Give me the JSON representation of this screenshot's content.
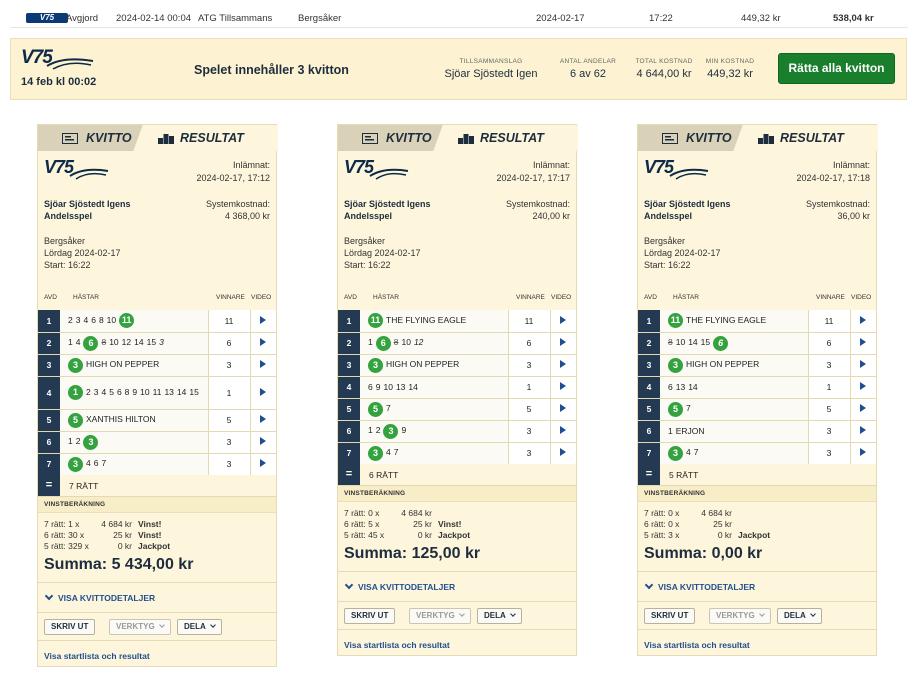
{
  "top_row": {
    "logo": "V75",
    "status": "Avgjord",
    "created": "2024-02-14 00:04",
    "type": "ATG Tillsammans",
    "track": "Bergsåker",
    "race_date": "2024-02-17",
    "time": "17:22",
    "min_cost": "449,32 kr",
    "total": "538,04 kr"
  },
  "banner": {
    "brand": "V75",
    "date": "14 feb kl 00:02",
    "info": "Spelet innehåller 3 kvitton",
    "stats": [
      {
        "label": "TILLSAMMANSLAG",
        "value": "Sjöar Sjöstedt Igen"
      },
      {
        "label": "ANTAL ANDELAR",
        "value": "6 av 62"
      },
      {
        "label": "TOTAL KOSTNAD",
        "value": "4 644,00 kr"
      },
      {
        "label": "MIN KOSTNAD",
        "value": "449,32 kr"
      }
    ],
    "fix_button": "Rätta alla kvitton"
  },
  "labels": {
    "tab_kvitto": "KVITTO",
    "tab_resultat": "RESULTAT",
    "inlamnat": "Inlämnat:",
    "systemkostnad": "Systemkostnad:",
    "col_avd": "AVD",
    "col_hastar": "HÄSTAR",
    "col_vinnare": "VINNARE",
    "col_video": "VIDEO",
    "eq": "=",
    "vinstberakning": "VINSTBERÄKNING",
    "visa_detaljer": "VISA KVITTODETALJER",
    "skriv_ut": "SKRIV UT",
    "verktyg": "VERKTYG",
    "dela": "DELA",
    "startlista": "Visa startlista och resultat"
  },
  "cards": [
    {
      "brand": "V75",
      "submitted": "2024-02-17, 17:12",
      "team_line1": "Sjöar Sjöstedt Igens",
      "team_line2": "Andelsspel",
      "system_cost": "4 368,00 kr",
      "track": "Bergsåker",
      "day": "Lördag 2024-02-17",
      "start": "Start: 16:22",
      "legs": [
        {
          "avd": "1",
          "winner": "11",
          "horses": [
            {
              "t": "2"
            },
            {
              "t": "3"
            },
            {
              "t": "4"
            },
            {
              "t": "6"
            },
            {
              "t": "8"
            },
            {
              "t": "10"
            },
            {
              "t": "11",
              "hit": true
            }
          ]
        },
        {
          "avd": "2",
          "winner": "6",
          "horses": [
            {
              "t": "1"
            },
            {
              "t": "4"
            },
            {
              "t": "6",
              "hit": true
            },
            {
              "t": "8",
              "strike": true
            },
            {
              "t": "10"
            },
            {
              "t": "12"
            },
            {
              "t": "14"
            },
            {
              "t": "15"
            },
            {
              "t": "3",
              "italic": true
            }
          ]
        },
        {
          "avd": "3",
          "winner": "3",
          "horses": [
            {
              "t": "3",
              "hit": true
            },
            {
              "t": "HIGH ON PEPPER"
            }
          ]
        },
        {
          "avd": "4",
          "winner": "1",
          "horses": [
            {
              "t": "1",
              "hit": true
            },
            {
              "t": "2"
            },
            {
              "t": "3"
            },
            {
              "t": "4"
            },
            {
              "t": "5"
            },
            {
              "t": "6"
            },
            {
              "t": "8"
            },
            {
              "t": "9"
            },
            {
              "t": "10"
            },
            {
              "t": "11"
            },
            {
              "t": "13"
            },
            {
              "t": "14"
            },
            {
              "t": "15"
            }
          ]
        },
        {
          "avd": "5",
          "winner": "5",
          "horses": [
            {
              "t": "5",
              "hit": true
            },
            {
              "t": "XANTHIS HILTON"
            }
          ]
        },
        {
          "avd": "6",
          "winner": "3",
          "horses": [
            {
              "t": "1"
            },
            {
              "t": "2"
            },
            {
              "t": "3",
              "hit": true
            }
          ]
        },
        {
          "avd": "7",
          "winner": "3",
          "horses": [
            {
              "t": "3",
              "hit": true
            },
            {
              "t": "4"
            },
            {
              "t": "6"
            },
            {
              "t": "7"
            }
          ]
        }
      ],
      "ratt": "7 RÄTT",
      "winnings": [
        {
          "rows": "7 rätt: 1 x",
          "amount": "4 684 kr",
          "result": "Vinst!"
        },
        {
          "rows": "6 rätt: 30 x",
          "amount": "25 kr",
          "result": "Vinst!"
        },
        {
          "rows": "5 rätt: 329 x",
          "amount": "0 kr",
          "result": "Jackpot"
        }
      ],
      "summa": "Summa: 5 434,00 kr"
    },
    {
      "brand": "V75",
      "submitted": "2024-02-17, 17:17",
      "team_line1": "Sjöar Sjöstedt Igens",
      "team_line2": "Andelsspel",
      "system_cost": "240,00 kr",
      "track": "Bergsåker",
      "day": "Lördag 2024-02-17",
      "start": "Start: 16:22",
      "legs": [
        {
          "avd": "1",
          "winner": "11",
          "horses": [
            {
              "t": "11",
              "hit": true
            },
            {
              "t": "THE FLYING EAGLE"
            }
          ]
        },
        {
          "avd": "2",
          "winner": "6",
          "horses": [
            {
              "t": "1"
            },
            {
              "t": "6",
              "hit": true
            },
            {
              "t": "8",
              "strike": true
            },
            {
              "t": "10"
            },
            {
              "t": "12",
              "italic": true
            }
          ]
        },
        {
          "avd": "3",
          "winner": "3",
          "horses": [
            {
              "t": "3",
              "hit": true
            },
            {
              "t": "HIGH ON PEPPER"
            }
          ]
        },
        {
          "avd": "4",
          "winner": "1",
          "horses": [
            {
              "t": "6"
            },
            {
              "t": "9"
            },
            {
              "t": "10"
            },
            {
              "t": "13"
            },
            {
              "t": "14"
            }
          ]
        },
        {
          "avd": "5",
          "winner": "5",
          "horses": [
            {
              "t": "5",
              "hit": true
            },
            {
              "t": "7"
            }
          ]
        },
        {
          "avd": "6",
          "winner": "3",
          "horses": [
            {
              "t": "1"
            },
            {
              "t": "2"
            },
            {
              "t": "3",
              "hit": true
            },
            {
              "t": "9"
            }
          ]
        },
        {
          "avd": "7",
          "winner": "3",
          "horses": [
            {
              "t": "3",
              "hit": true
            },
            {
              "t": "4"
            },
            {
              "t": "7"
            }
          ]
        }
      ],
      "ratt": "6 RÄTT",
      "winnings": [
        {
          "rows": "7 rätt: 0 x",
          "amount": "4 684 kr",
          "result": ""
        },
        {
          "rows": "6 rätt: 5 x",
          "amount": "25 kr",
          "result": "Vinst!"
        },
        {
          "rows": "5 rätt: 45 x",
          "amount": "0 kr",
          "result": "Jackpot"
        }
      ],
      "summa": "Summa: 125,00 kr"
    },
    {
      "brand": "V75",
      "submitted": "2024-02-17, 17:18",
      "team_line1": "Sjöar Sjöstedt Igens",
      "team_line2": "Andelsspel",
      "system_cost": "36,00 kr",
      "track": "Bergsåker",
      "day": "Lördag 2024-02-17",
      "start": "Start: 16:22",
      "legs": [
        {
          "avd": "1",
          "winner": "11",
          "horses": [
            {
              "t": "11",
              "hit": true
            },
            {
              "t": "THE FLYING EAGLE"
            }
          ]
        },
        {
          "avd": "2",
          "winner": "6",
          "horses": [
            {
              "t": "8",
              "strike": true
            },
            {
              "t": "10"
            },
            {
              "t": "14"
            },
            {
              "t": "15"
            },
            {
              "t": "6",
              "hit": true,
              "italic": true
            }
          ]
        },
        {
          "avd": "3",
          "winner": "3",
          "horses": [
            {
              "t": "3",
              "hit": true
            },
            {
              "t": "HIGH ON PEPPER"
            }
          ]
        },
        {
          "avd": "4",
          "winner": "1",
          "horses": [
            {
              "t": "6"
            },
            {
              "t": "13"
            },
            {
              "t": "14"
            }
          ]
        },
        {
          "avd": "5",
          "winner": "5",
          "horses": [
            {
              "t": "5",
              "hit": true
            },
            {
              "t": "7"
            }
          ]
        },
        {
          "avd": "6",
          "winner": "3",
          "horses": [
            {
              "t": "1"
            },
            {
              "t": "ERJON"
            }
          ]
        },
        {
          "avd": "7",
          "winner": "3",
          "horses": [
            {
              "t": "3",
              "hit": true
            },
            {
              "t": "4"
            },
            {
              "t": "7"
            }
          ]
        }
      ],
      "ratt": "5 RÄTT",
      "winnings": [
        {
          "rows": "7 rätt: 0 x",
          "amount": "4 684 kr",
          "result": ""
        },
        {
          "rows": "6 rätt: 0 x",
          "amount": "25 kr",
          "result": ""
        },
        {
          "rows": "5 rätt: 3 x",
          "amount": "0 kr",
          "result": "Jackpot"
        }
      ],
      "summa": "Summa: 0,00 kr"
    }
  ]
}
